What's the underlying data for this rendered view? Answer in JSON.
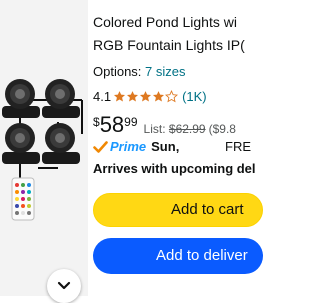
{
  "product": {
    "title_line1": "Colored Pond Lights wi",
    "title_line2": "RGB Fountain Lights IP("
  },
  "options": {
    "label": "Options:",
    "link": "7 sizes"
  },
  "rating": {
    "value": "4.1",
    "stars": 4.1,
    "count": "(1K)"
  },
  "price": {
    "currency": "$",
    "dollars": "58",
    "cents": "99",
    "list_label": "List:",
    "list_value": "$62.99",
    "unit_partial": "($9.8"
  },
  "delivery": {
    "prime_label": "Prime",
    "day": "Sun,",
    "free_label": "FRE",
    "arrives": "Arrives with upcoming del"
  },
  "buttons": {
    "add_to_cart": "Add to cart",
    "add_to_delivery": "Add to deliver"
  },
  "colors": {
    "cart_button": "#ffd814",
    "delivery_button": "#0a5bff",
    "link": "#007185",
    "star": "#de7921",
    "prime": "#1a98ff",
    "checkmark": "#f08804"
  },
  "icons": [
    "product-image",
    "star-icon",
    "prime-checkmark-icon",
    "chevron-down-icon"
  ]
}
